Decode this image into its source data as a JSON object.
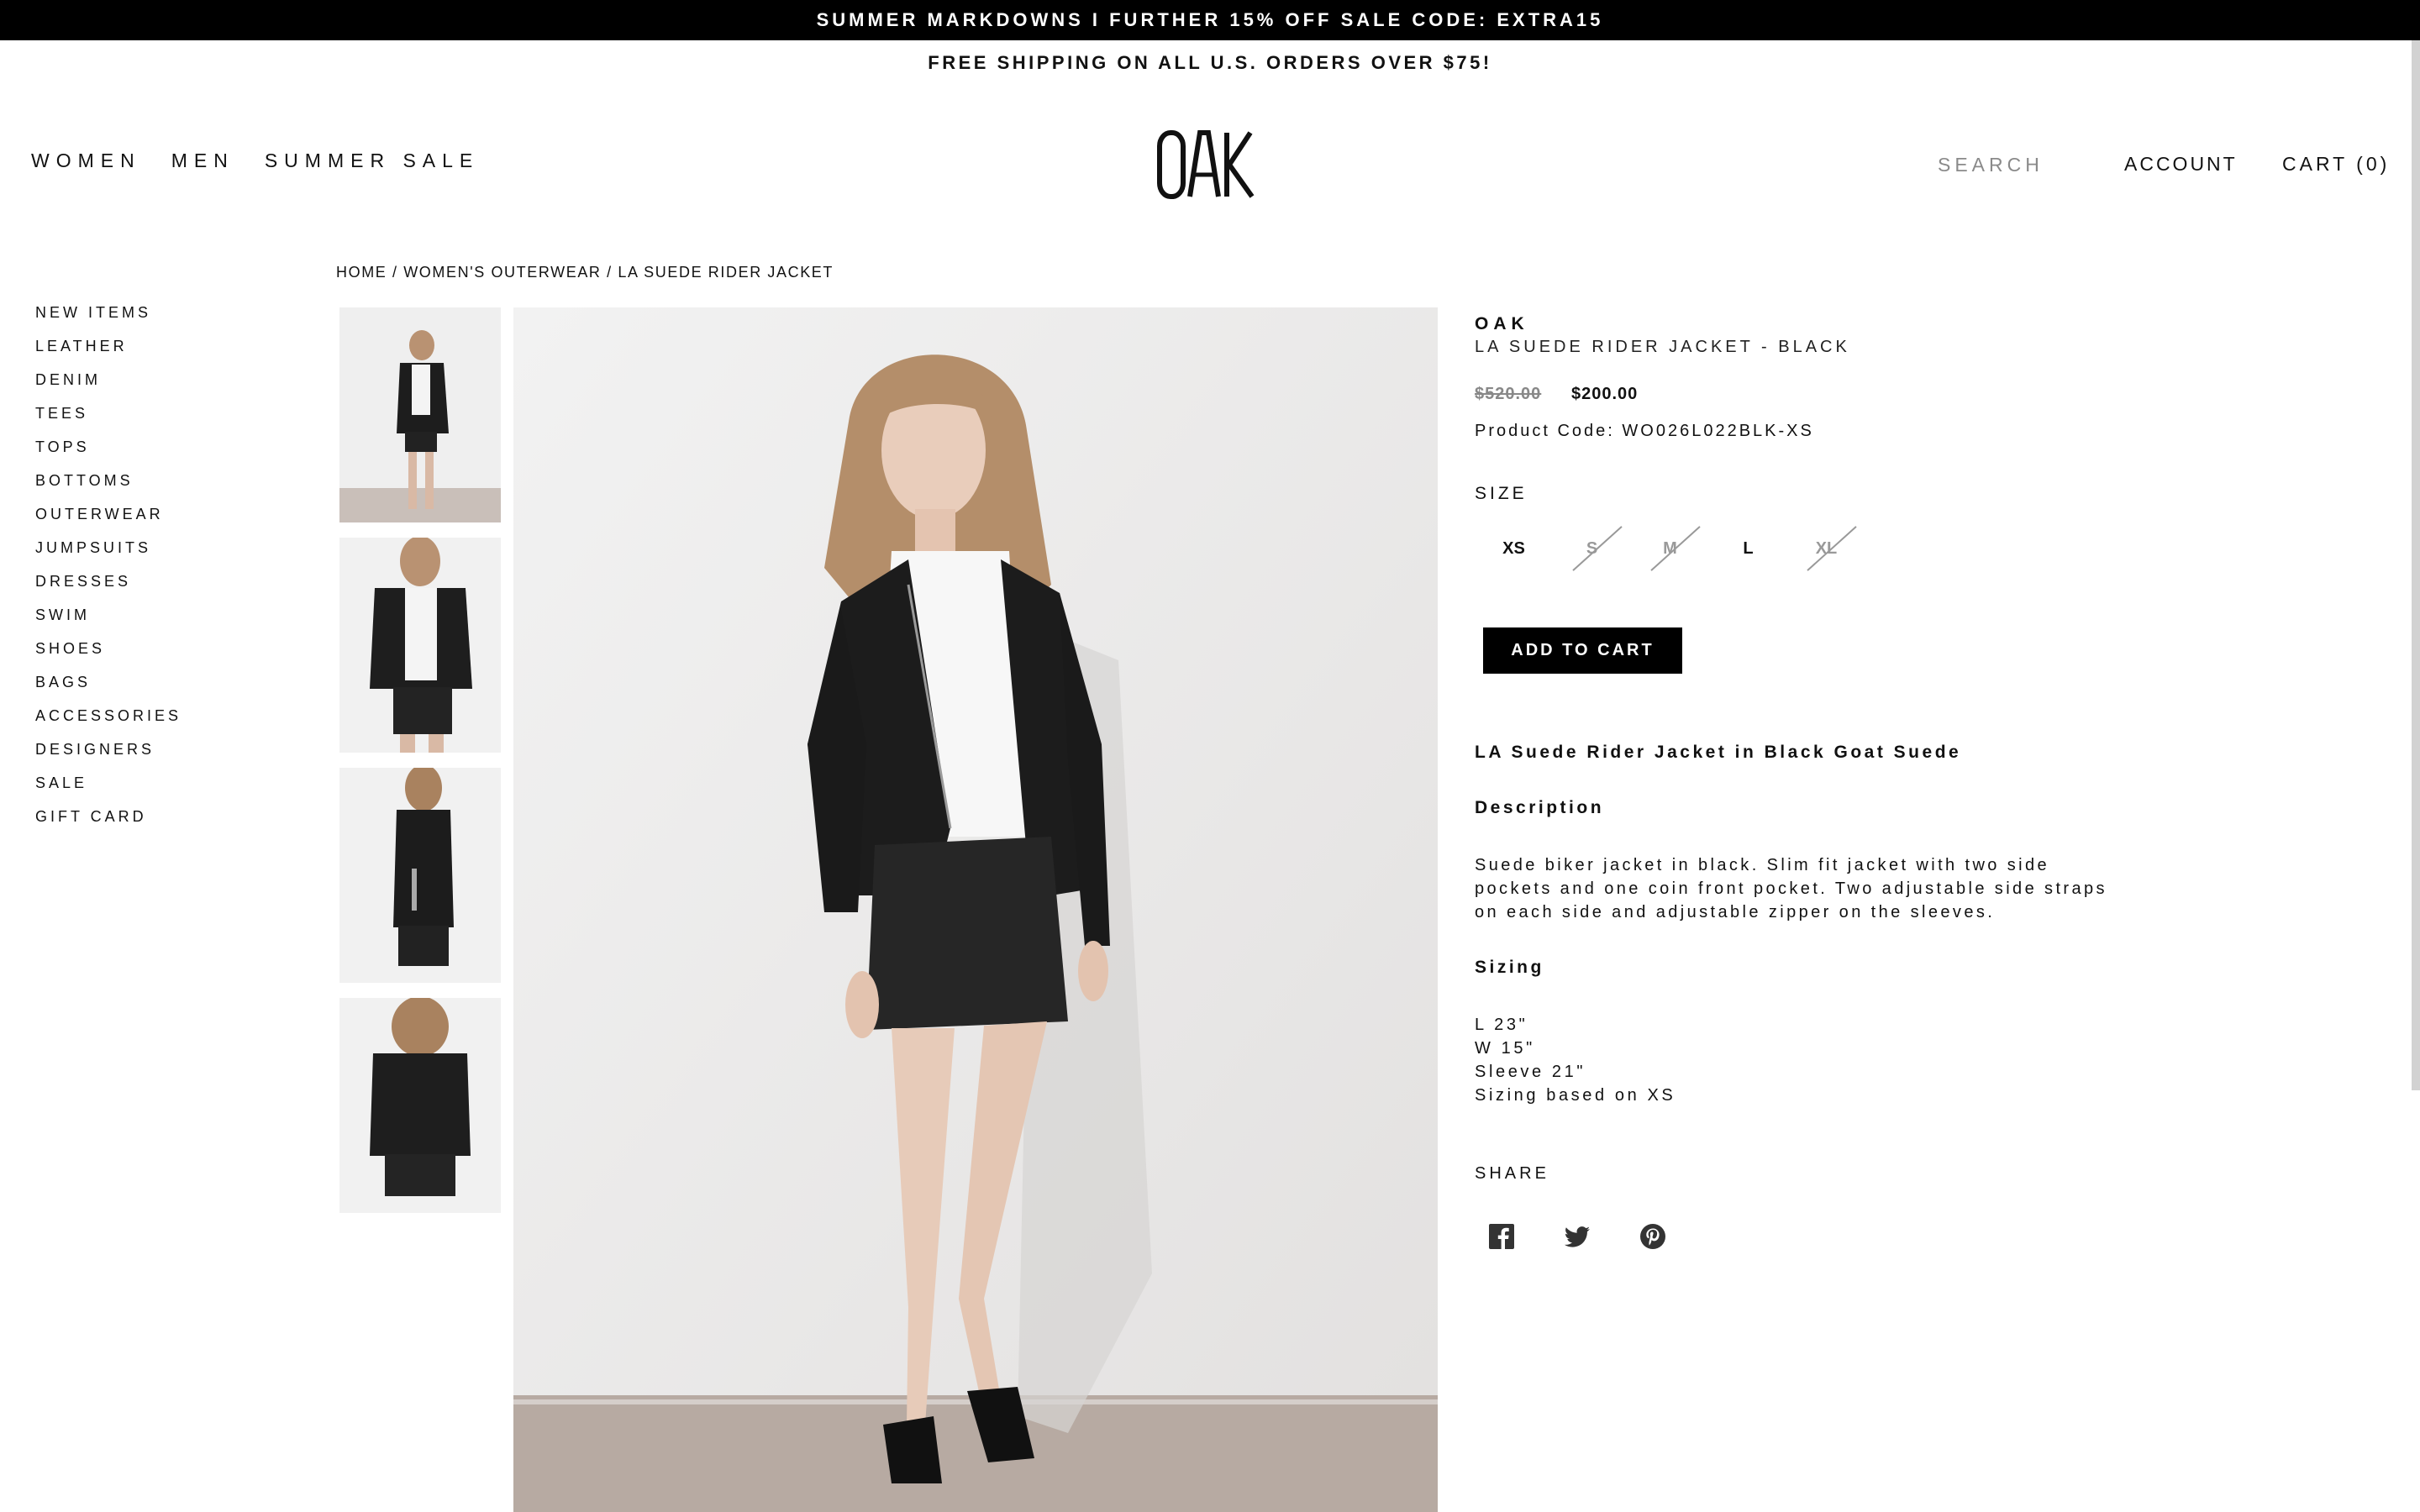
{
  "announcement": {
    "promo": "SUMMER MARKDOWNS I FURTHER 15% OFF SALE CODE: EXTRA15",
    "shipping": "FREE SHIPPING ON ALL U.S. ORDERS OVER $75!"
  },
  "header": {
    "nav": [
      "WOMEN",
      "MEN",
      "SUMMER SALE"
    ],
    "logo": "OAK",
    "search_placeholder": "SEARCH",
    "account": "ACCOUNT",
    "cart": "CART (0)"
  },
  "breadcrumb": {
    "home": "HOME",
    "sep": " / ",
    "category": "WOMEN'S OUTERWEAR",
    "current": "LA SUEDE RIDER JACKET"
  },
  "sidebar": {
    "items": [
      "NEW ITEMS",
      "LEATHER",
      "DENIM",
      "TEES",
      "TOPS",
      "BOTTOMS",
      "OUTERWEAR",
      "JUMPSUITS",
      "DRESSES",
      "SWIM",
      "SHOES",
      "BAGS",
      "ACCESSORIES",
      "DESIGNERS",
      "SALE",
      "GIFT CARD"
    ]
  },
  "product": {
    "brand": "OAK",
    "name": "LA SUEDE RIDER JACKET - BLACK",
    "old_price": "$520.00",
    "price": "$200.00",
    "code": "Product Code: WO026L022BLK-XS",
    "size_label": "SIZE",
    "sizes": [
      {
        "label": "XS",
        "available": true
      },
      {
        "label": "S",
        "available": false
      },
      {
        "label": "M",
        "available": false
      },
      {
        "label": "L",
        "available": true
      },
      {
        "label": "XL",
        "available": false
      }
    ],
    "add_to_cart": "ADD TO CART",
    "headline": "LA Suede Rider Jacket in Black Goat Suede",
    "description_title": "Description",
    "description": "Suede biker jacket in black. Slim fit jacket with two side pockets and one coin front pocket. Two adjustable side straps on each side and adjustable zipper on the sleeves.",
    "sizing_title": "Sizing",
    "sizing": [
      "L 23\"",
      "W 15\"",
      "Sleeve 21\"",
      "Sizing based on XS"
    ],
    "share_label": "SHARE"
  },
  "icons": {
    "share": [
      "facebook-icon",
      "twitter-icon",
      "pinterest-icon"
    ]
  },
  "colors": {
    "topbar_bg": "#000000",
    "button_bg": "#000000",
    "unavailable": "#999999"
  }
}
